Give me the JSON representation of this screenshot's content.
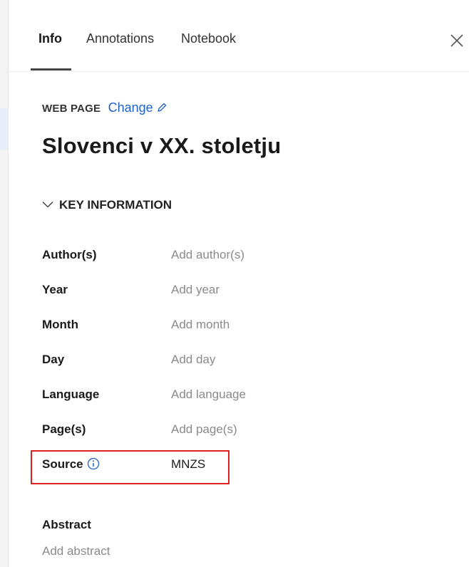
{
  "tabs": [
    {
      "label": "Info",
      "active": true
    },
    {
      "label": "Annotations",
      "active": false
    },
    {
      "label": "Notebook",
      "active": false
    }
  ],
  "close_icon": "close-icon",
  "item": {
    "type_label": "WEB PAGE",
    "change_label": "Change",
    "change_icon": "pencil-icon",
    "title": "Slovenci v XX. stoletju"
  },
  "key_information": {
    "heading": "KEY INFORMATION",
    "expanded": true,
    "fields": [
      {
        "label": "Author(s)",
        "value": "Add author(s)",
        "placeholder": true
      },
      {
        "label": "Year",
        "value": "Add year",
        "placeholder": true
      },
      {
        "label": "Month",
        "value": "Add month",
        "placeholder": true
      },
      {
        "label": "Day",
        "value": "Add day",
        "placeholder": true
      },
      {
        "label": "Language",
        "value": "Add language",
        "placeholder": true
      },
      {
        "label": "Page(s)",
        "value": "Add page(s)",
        "placeholder": true
      },
      {
        "label": "Source",
        "value": "MNZS",
        "placeholder": false,
        "info_icon": "info-icon"
      }
    ]
  },
  "abstract": {
    "label": "Abstract",
    "placeholder": "Add abstract"
  },
  "colors": {
    "link": "#1f62c8",
    "placeholder_text": "#8a8a8a",
    "highlight_border": "#e02020"
  }
}
